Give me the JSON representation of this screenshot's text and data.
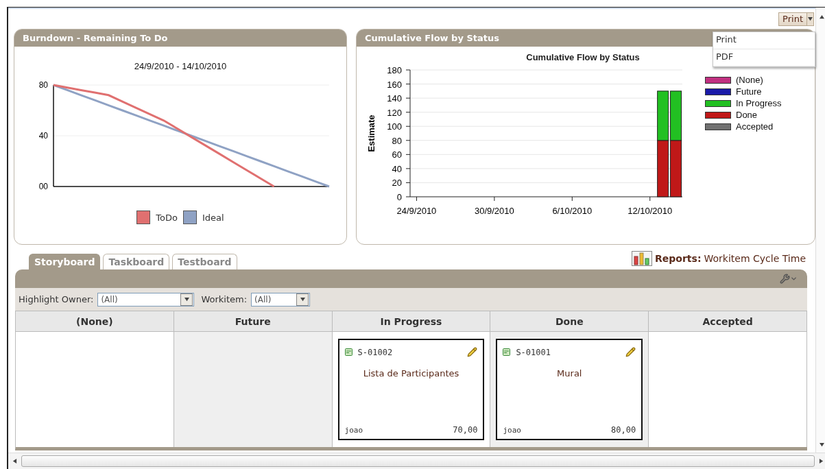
{
  "print_button": {
    "label": "Print"
  },
  "print_menu": {
    "items": [
      {
        "label": "Print"
      },
      {
        "label": "PDF"
      }
    ]
  },
  "burndown": {
    "title": "Burndown - Remaining To Do",
    "subtitle": "24/9/2010 - 14/10/2010",
    "chart_data": {
      "type": "line",
      "grid": true,
      "categories": [
        null,
        null,
        null,
        null,
        null,
        null,
        null,
        null,
        null,
        null,
        null,
        null,
        null,
        null,
        null,
        null,
        null,
        null,
        null,
        null,
        null
      ],
      "ylim": [
        0,
        80
      ],
      "yticks": [
        {
          "value": 0,
          "label": "00"
        },
        {
          "value": 40,
          "label": "40"
        },
        {
          "value": 80,
          "label": "80"
        }
      ],
      "series": [
        {
          "name": "ToDo",
          "color": "#e07070",
          "values": [
            80,
            78,
            76,
            74,
            72,
            67,
            62,
            57,
            52,
            45.5,
            39,
            32.5,
            26,
            19.5,
            13,
            6.5,
            0,
            null,
            null,
            null,
            null
          ]
        },
        {
          "name": "Ideal",
          "color": "#8fa2c4",
          "values": [
            80,
            76,
            72,
            68,
            64,
            60,
            56,
            52,
            48,
            44,
            40,
            36,
            32,
            28,
            24,
            20,
            16,
            12,
            8,
            4,
            0
          ]
        }
      ]
    }
  },
  "cumulative": {
    "title": "Cumulative Flow by Status",
    "chart_data": {
      "type": "bar",
      "stacked": true,
      "grid": true,
      "title": "Cumulative Flow by Status",
      "ylabel": "Estimate",
      "ylim": [
        0,
        180
      ],
      "categories": [
        "24/9/2010",
        null,
        null,
        null,
        null,
        null,
        "30/9/2010",
        null,
        null,
        null,
        null,
        null,
        "6/10/2010",
        null,
        null,
        null,
        null,
        null,
        "12/10/2010",
        null,
        null
      ],
      "yticks": [
        0,
        20,
        40,
        60,
        80,
        100,
        120,
        140,
        160,
        180
      ],
      "series": [
        {
          "name": "(None)",
          "color": "#c03080",
          "values": [
            null,
            null,
            null,
            null,
            null,
            null,
            null,
            null,
            null,
            null,
            null,
            null,
            null,
            null,
            null,
            null,
            null,
            null,
            null,
            0,
            0
          ]
        },
        {
          "name": "Future",
          "color": "#1a1aa8",
          "values": [
            null,
            null,
            null,
            null,
            null,
            null,
            null,
            null,
            null,
            null,
            null,
            null,
            null,
            null,
            null,
            null,
            null,
            null,
            null,
            0,
            0
          ]
        },
        {
          "name": "In Progress",
          "color": "#22c022",
          "values": [
            null,
            null,
            null,
            null,
            null,
            null,
            null,
            null,
            null,
            null,
            null,
            null,
            null,
            null,
            null,
            null,
            null,
            null,
            null,
            70,
            70
          ]
        },
        {
          "name": "Done",
          "color": "#c01818",
          "values": [
            null,
            null,
            null,
            null,
            null,
            null,
            null,
            null,
            null,
            null,
            null,
            null,
            null,
            null,
            null,
            null,
            null,
            null,
            null,
            80,
            80
          ]
        },
        {
          "name": "Accepted",
          "color": "#707070",
          "values": [
            null,
            null,
            null,
            null,
            null,
            null,
            null,
            null,
            null,
            null,
            null,
            null,
            null,
            null,
            null,
            null,
            null,
            null,
            null,
            0,
            0
          ]
        }
      ]
    }
  },
  "tabs": [
    {
      "label": "Storyboard",
      "selected": true
    },
    {
      "label": "Taskboard",
      "selected": false
    },
    {
      "label": "Testboard",
      "selected": false
    }
  ],
  "reports": {
    "label": "Reports:",
    "link": "Workitem Cycle Time"
  },
  "filters": [
    {
      "label": "Highlight Owner:",
      "value": "(All)"
    },
    {
      "label": "Workitem:",
      "value": "(All)"
    }
  ],
  "columns": [
    {
      "title": "(None)"
    },
    {
      "title": "Future"
    },
    {
      "title": "In Progress",
      "cards": [
        {
          "id": "S-01002",
          "title": "Lista de Participantes",
          "owner": "joao",
          "estimate": "70,00"
        }
      ]
    },
    {
      "title": "Done",
      "cards": [
        {
          "id": "S-01001",
          "title": "Mural",
          "owner": "joao",
          "estimate": "80,00"
        }
      ]
    },
    {
      "title": "Accepted"
    }
  ]
}
